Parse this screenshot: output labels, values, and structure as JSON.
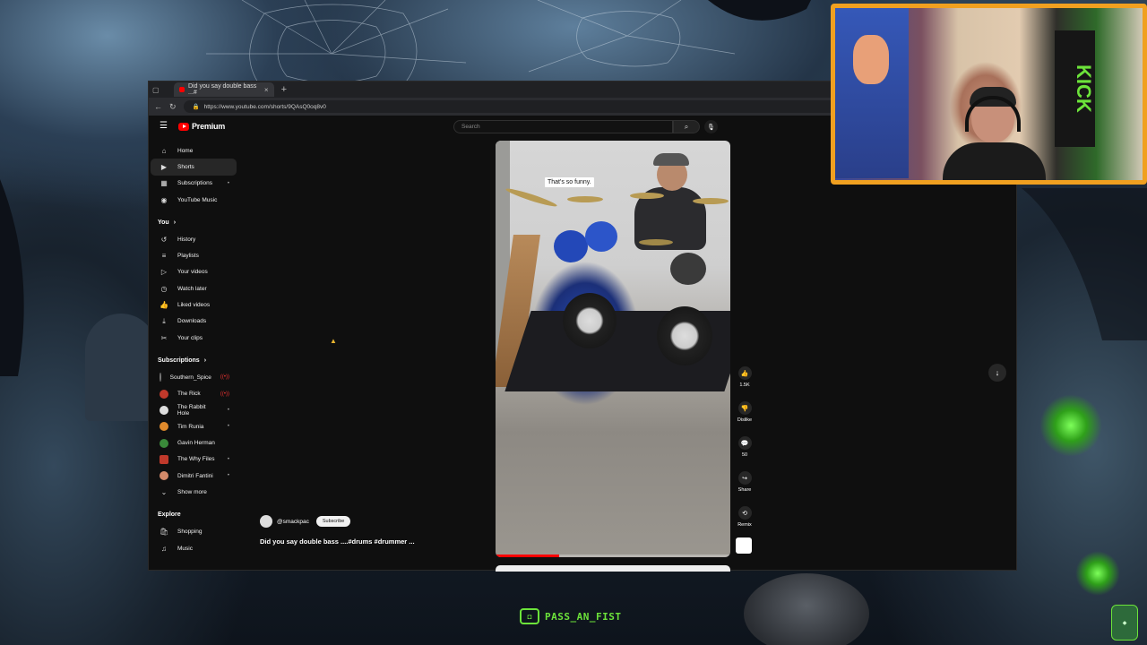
{
  "browser": {
    "tab_title": "Did you say double bass ...#",
    "tab_close": "×",
    "new_tab": "+",
    "url": "https://www.youtube.com/shorts/9QAsQ0oq8v0"
  },
  "youtube": {
    "logo_text": "Premium",
    "search_placeholder": "Search",
    "nav": [
      {
        "label": "Home",
        "icon": "⌂"
      },
      {
        "label": "Shorts",
        "icon": "▶"
      },
      {
        "label": "Subscriptions",
        "icon": "▦",
        "dot": "•"
      },
      {
        "label": "YouTube Music",
        "icon": "◉"
      }
    ],
    "you_section": {
      "title": "You",
      "items": [
        {
          "label": "History",
          "icon": "↺"
        },
        {
          "label": "Playlists",
          "icon": "≡"
        },
        {
          "label": "Your videos",
          "icon": "▷"
        },
        {
          "label": "Watch later",
          "icon": "◷"
        },
        {
          "label": "Liked videos",
          "icon": "👍"
        },
        {
          "label": "Downloads",
          "icon": "⤓"
        },
        {
          "label": "Your clips",
          "icon": "✂"
        }
      ]
    },
    "subscriptions_section": {
      "title": "Subscriptions",
      "items": [
        {
          "label": "Southern_Spice",
          "avatar_color": "#777777",
          "dot": "((•))"
        },
        {
          "label": "The Rick",
          "avatar_color": "#c0392b",
          "dot": "((•))"
        },
        {
          "label": "The Rabbit Hole",
          "avatar_color": "#dddddd",
          "dot": "•"
        },
        {
          "label": "Tim Runia",
          "avatar_color": "#e08a2c",
          "dot": "•"
        },
        {
          "label": "Gavin Herman",
          "avatar_color": "#3a8a3a",
          "dot": ""
        },
        {
          "label": "The Why Files",
          "avatar_color": "#c0392b",
          "dot": "•"
        },
        {
          "label": "Dimitri Fantini",
          "avatar_color": "#d48a6a",
          "dot": "•"
        }
      ],
      "show_more": "Show more"
    },
    "explore_section": {
      "title": "Explore",
      "items": [
        {
          "label": "Shopping",
          "icon": "🛍"
        },
        {
          "label": "Music",
          "icon": "♫"
        }
      ]
    },
    "short": {
      "caption": "That's so funny.",
      "channel": "@smackpac",
      "subscribe": "Subscribe",
      "title": "Did you say double bass ....#drums #drummer ...",
      "progress": 0.27,
      "actions": [
        {
          "icon": "👍",
          "label": "1.5K"
        },
        {
          "icon": "👎",
          "label": "Dislike"
        },
        {
          "icon": "💬",
          "label": "50"
        },
        {
          "icon": "↪",
          "label": "Share"
        },
        {
          "icon": "⟲",
          "label": "Remix"
        }
      ]
    }
  },
  "overlay": {
    "streamer_name": "PASS_AN_FIST",
    "cam_banner": "KICK"
  },
  "colors": {
    "accent": "#ff0000",
    "stream_green": "#6ce33a",
    "cam_border": "#f0a020"
  }
}
